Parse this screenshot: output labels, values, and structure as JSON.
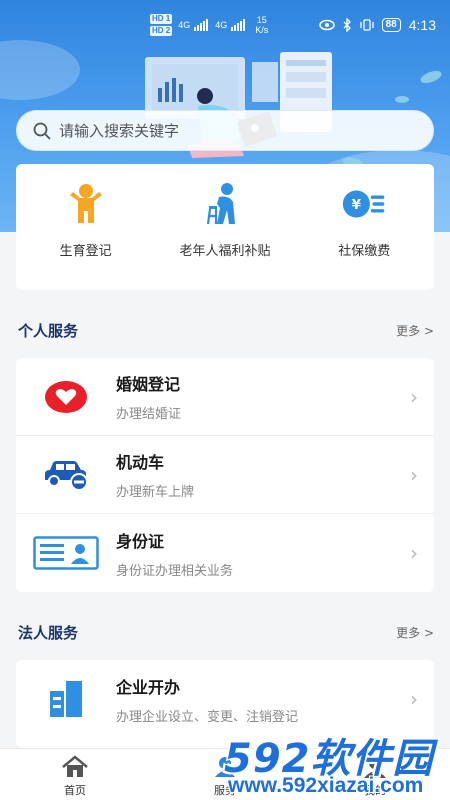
{
  "status_bar": {
    "hd1": "HD 1",
    "hd2": "HD 2",
    "net1": "4G",
    "net2": "4G",
    "speed_value": "15",
    "speed_unit": "K/s",
    "battery": "88",
    "time": "4:13"
  },
  "search": {
    "placeholder": "请输入搜索关键字",
    "icon": "search-icon"
  },
  "quick_actions": [
    {
      "label": "生育登记",
      "icon": "child-icon",
      "color": "#f5a623"
    },
    {
      "label": "老年人福利补贴",
      "icon": "elderly-icon",
      "color": "#2f8fe0"
    },
    {
      "label": "社保缴费",
      "icon": "yuan-coin-icon",
      "color": "#2f8fe0"
    }
  ],
  "personal": {
    "title": "个人服务",
    "more": "更多 >",
    "items": [
      {
        "title": "婚姻登记",
        "subtitle": "办理结婚证",
        "icon": "heart-icon"
      },
      {
        "title": "机动车",
        "subtitle": "办理新车上牌",
        "icon": "car-icon"
      },
      {
        "title": "身份证",
        "subtitle": "身份证办理相关业务",
        "icon": "id-card-icon"
      }
    ]
  },
  "legal": {
    "title": "法人服务",
    "more": "更多 >",
    "items": [
      {
        "title": "企业开办",
        "subtitle": "办理企业设立、变更、注销登记",
        "icon": "building-icon"
      }
    ]
  },
  "bottom_nav": [
    {
      "label": "首页",
      "icon": "home-icon"
    },
    {
      "label": "服务",
      "icon": "service-icon"
    },
    {
      "label": "我的",
      "icon": "user-icon"
    }
  ],
  "watermark": {
    "logo": "592软件园",
    "url": "www.592xiazai.com"
  },
  "colors": {
    "primary": "#2f84de",
    "heart": "#e8202a",
    "accent_orange": "#f5a623",
    "title_navy": "#18366b"
  }
}
